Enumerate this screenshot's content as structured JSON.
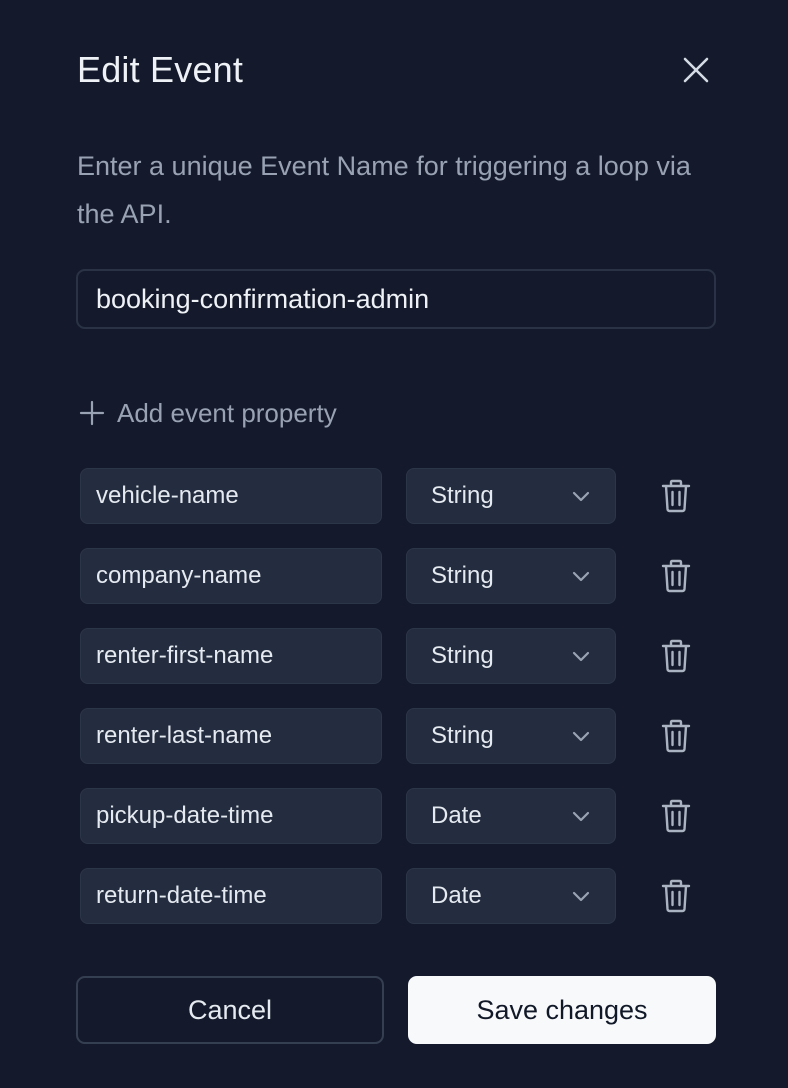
{
  "dialog": {
    "title": "Edit Event",
    "description": "Enter a unique Event Name for triggering a loop via the API.",
    "event_name_value": "booking-confirmation-admin",
    "add_property_label": "Add event property",
    "properties": [
      {
        "name": "vehicle-name",
        "type": "String"
      },
      {
        "name": "company-name",
        "type": "String"
      },
      {
        "name": "renter-first-name",
        "type": "String"
      },
      {
        "name": "renter-last-name",
        "type": "String"
      },
      {
        "name": "pickup-date-time",
        "type": "Date"
      },
      {
        "name": "return-date-time",
        "type": "Date"
      }
    ],
    "cancel_label": "Cancel",
    "save_label": "Save changes"
  },
  "icons": {
    "close": "close-icon",
    "add": "plus-icon",
    "chevron": "chevron-down-icon",
    "delete": "trash-icon"
  },
  "colors": {
    "background": "#141a2b",
    "field_background": "#232d3f",
    "muted_text": "#98a2b3",
    "primary_button": "#f8f9fb"
  }
}
